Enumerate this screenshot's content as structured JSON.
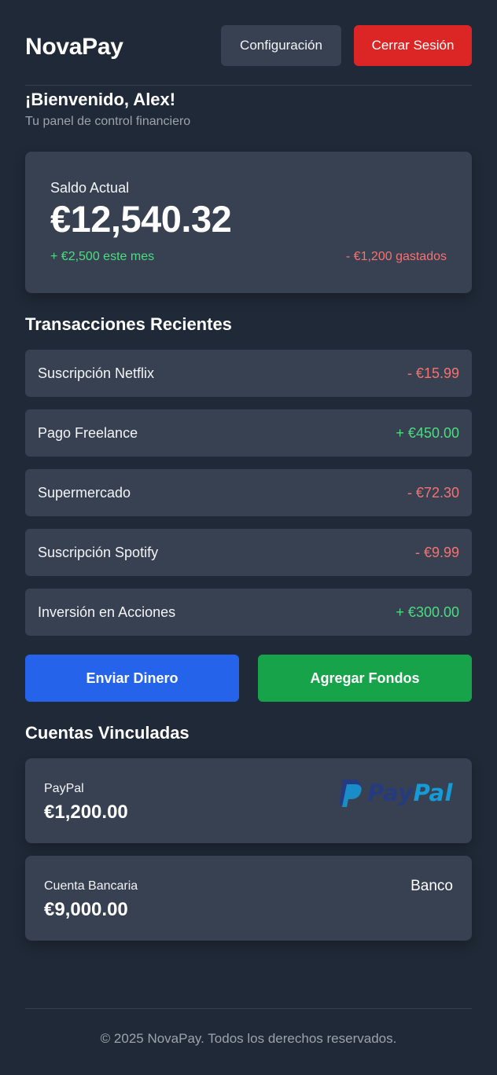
{
  "header": {
    "brand": "NovaPay",
    "settings_label": "Configuración",
    "logout_label": "Cerrar Sesión"
  },
  "welcome": {
    "title": "¡Bienvenido, Alex!",
    "subtitle": "Tu panel de control financiero"
  },
  "balance": {
    "label": "Saldo Actual",
    "amount": "€12,540.32",
    "income": "+ €2,500 este mes",
    "spent": "- €1,200 gastados"
  },
  "transactions": {
    "title": "Transacciones Recientes",
    "items": [
      {
        "name": "Suscripción Netflix",
        "amount": "- €15.99",
        "type": "debit"
      },
      {
        "name": "Pago Freelance",
        "amount": "+ €450.00",
        "type": "credit"
      },
      {
        "name": "Supermercado",
        "amount": "- €72.30",
        "type": "debit"
      },
      {
        "name": "Suscripción Spotify",
        "amount": "- €9.99",
        "type": "debit"
      },
      {
        "name": "Inversión en Acciones",
        "amount": "+ €300.00",
        "type": "credit"
      }
    ]
  },
  "actions": {
    "send_label": "Enviar Dinero",
    "add_label": "Agregar Fondos"
  },
  "linked_accounts": {
    "title": "Cuentas Vinculadas",
    "items": [
      {
        "name": "PayPal",
        "balance": "€1,200.00",
        "logo": "PayPal"
      },
      {
        "name": "Cuenta Bancaria",
        "balance": "€9,000.00",
        "logo": "Banco"
      }
    ]
  },
  "footer": {
    "text": "© 2025 NovaPay. Todos los derechos reservados."
  },
  "colors": {
    "background": "#1f2937",
    "card": "#374151",
    "danger": "#dc2626",
    "primary": "#2563eb",
    "success": "#16a34a",
    "credit_text": "#4ade80",
    "debit_text": "#f87171",
    "paypal_dark": "#253b80",
    "paypal_light": "#179bd7"
  }
}
